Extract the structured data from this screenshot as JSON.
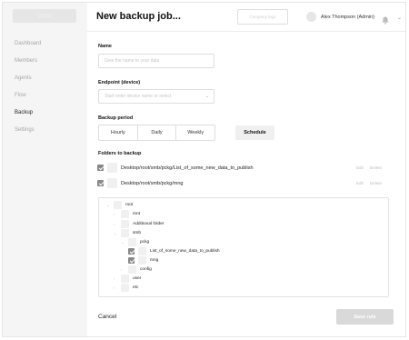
{
  "sidebar": {
    "logo": "LOGO",
    "items": [
      {
        "label": "Dashboard"
      },
      {
        "label": "Members"
      },
      {
        "label": "Agents"
      },
      {
        "label": "Flow"
      },
      {
        "label": "Backup"
      },
      {
        "label": "Settings"
      }
    ]
  },
  "header": {
    "title": "New backup job...",
    "company_logo": "Company logo",
    "user_name": "Alex Thompson (Admin)",
    "icons": [
      "bell-icon",
      "chevron-down-icon"
    ]
  },
  "form": {
    "name": {
      "label": "Name",
      "placeholder": "Give the name to your data"
    },
    "endpoint": {
      "label": "Endpoint (device)",
      "placeholder": "Start enter device name or select"
    },
    "period": {
      "label": "Backup period",
      "options": [
        "Hourly",
        "Daily",
        "Weekly"
      ],
      "schedule_label": "Schedule"
    },
    "folders": {
      "label": "Folders to backup",
      "selected": [
        {
          "path": "Desktop/root/smb/pckg/List_of_some_new_data_to_publish",
          "edit": "Edit",
          "delete": "Delete"
        },
        {
          "path": "Desktop/root/smb/pckg/mng",
          "edit": "Edit",
          "delete": "Delete"
        }
      ],
      "tree": [
        "root",
        "mnt",
        "Additional folder",
        "smb",
        "pckg",
        "List_of_some_new_data_to_publish",
        "mng",
        "config",
        "user",
        "etc"
      ]
    }
  },
  "footer": {
    "cancel_label": "Cancel",
    "save_label": "Save rule"
  }
}
